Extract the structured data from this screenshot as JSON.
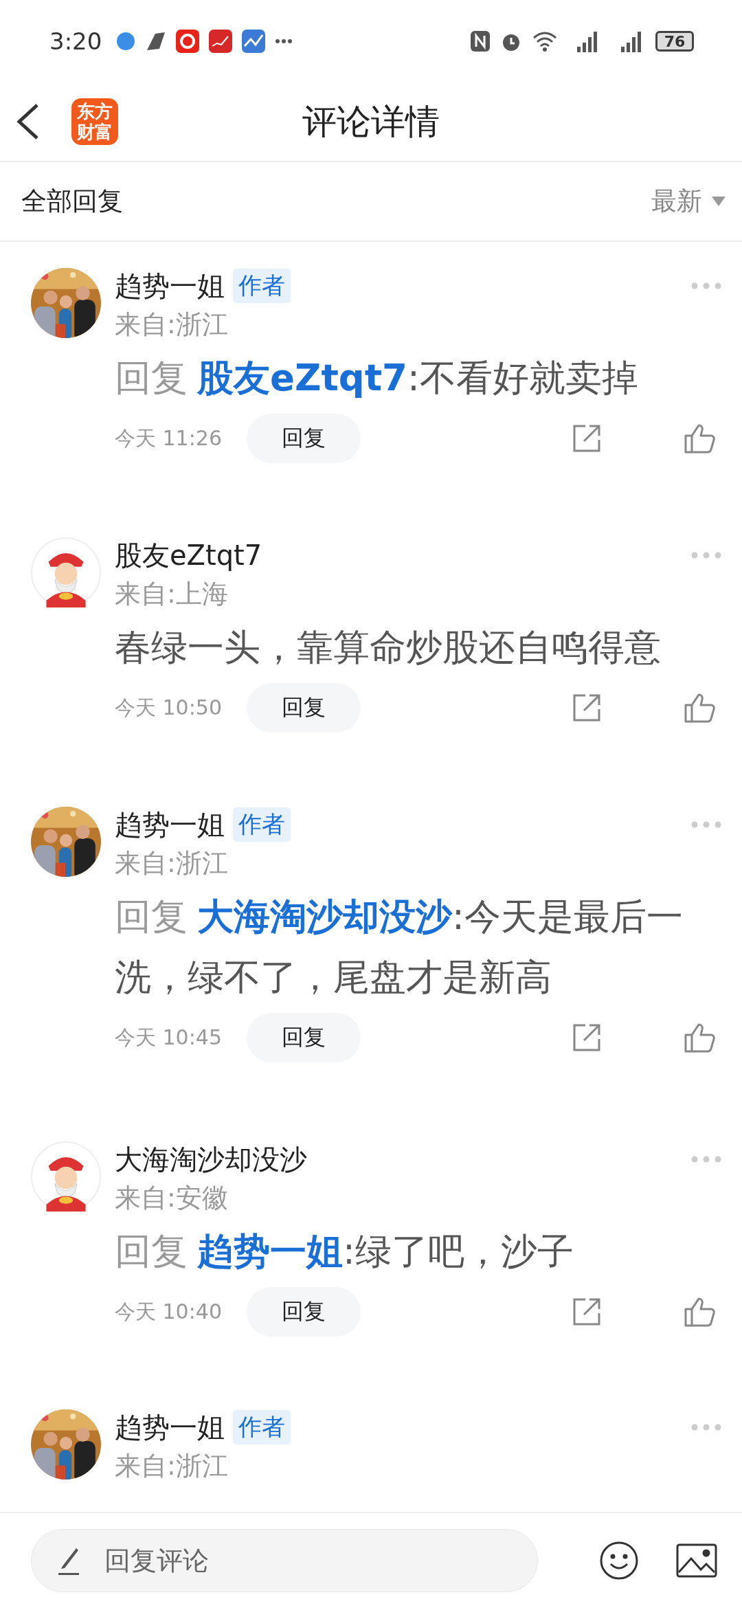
{
  "status_bar": {
    "time": "3:20",
    "battery": "76"
  },
  "header": {
    "logo": "东方财富",
    "title": "评论详情"
  },
  "sub_header": {
    "label": "全部回复",
    "sort": "最新"
  },
  "comments": [
    {
      "author": "趋势一姐",
      "badge": "作者",
      "location": "来自:浙江",
      "reply_prefix": "回复",
      "reply_to": "股友eZtqt7",
      "text": ":不看好就卖掉",
      "time": "今天 11:26",
      "reply_button": "回复"
    },
    {
      "avatar": {
        "kind": "default"
      },
      "author": "股友eZtqt7",
      "location": "来自:上海",
      "text": "春绿一头，靠算命炒股还自鸣得意",
      "time": "今天 10:50",
      "reply_button": "回复"
    },
    {
      "author": "趋势一姐",
      "badge": "作者",
      "location": "来自:浙江",
      "reply_prefix": "回复",
      "reply_to": "大海淘沙却没沙",
      "text": ":今天是最后一洗，绿不了，尾盘才是新高",
      "time": "今天 10:45",
      "reply_button": "回复"
    },
    {
      "avatar": {
        "kind": "default"
      },
      "author": "大海淘沙却没沙",
      "location": "来自:安徽",
      "reply_prefix": "回复",
      "reply_to": "趋势一姐",
      "text": ":绿了吧，沙子",
      "time": "今天 10:40",
      "reply_button": "回复"
    },
    {
      "author": "趋势一姐",
      "badge": "作者",
      "location": "来自:浙江"
    }
  ],
  "composer": {
    "placeholder": "回复评论"
  }
}
